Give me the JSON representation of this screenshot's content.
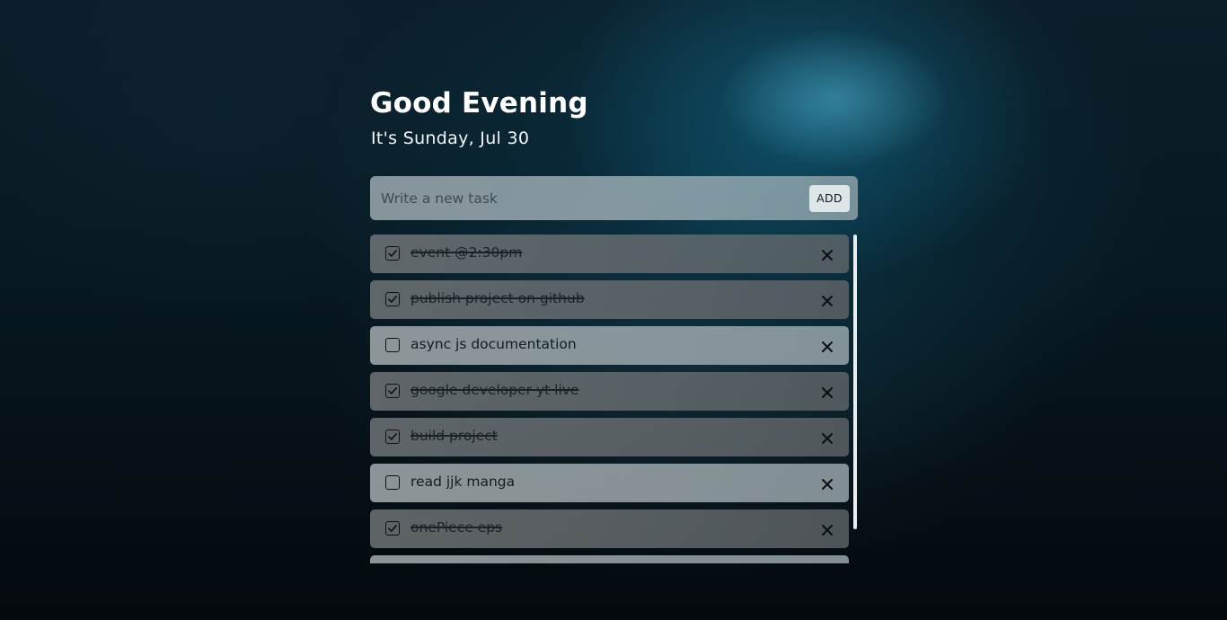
{
  "header": {
    "greeting": "Good Evening",
    "date_text": "It's Sunday, Jul 30"
  },
  "task_form": {
    "placeholder": "Write a new task",
    "value": "",
    "add_label": "ADD"
  },
  "tasks": [
    {
      "text": "event @2:30pm",
      "completed": true
    },
    {
      "text": "publish project on github",
      "completed": true
    },
    {
      "text": "async js documentation",
      "completed": false
    },
    {
      "text": "google developer yt live",
      "completed": true
    },
    {
      "text": "build project",
      "completed": true
    },
    {
      "text": "read jjk manga",
      "completed": false
    },
    {
      "text": "onePiece eps",
      "completed": true
    },
    {
      "text": "",
      "completed": false
    }
  ],
  "icons": {
    "checkbox": "checkbox-icon",
    "delete": "close-icon"
  },
  "colors": {
    "heading": "#ffffff",
    "scrollbar_thumb": "#e9eef0",
    "add_button_bg": "#dfe6e8"
  }
}
